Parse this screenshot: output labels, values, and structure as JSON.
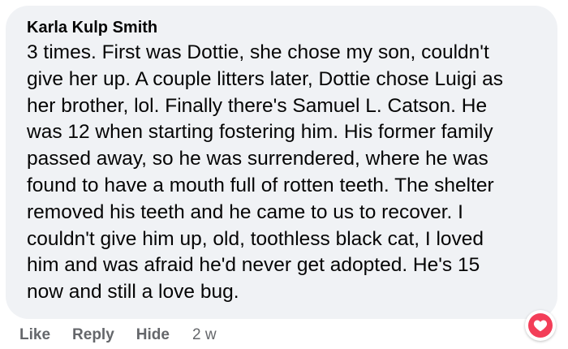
{
  "comment": {
    "author": "Karla Kulp Smith",
    "text": "3 times. First was Dottie, she chose my son, couldn't\ngive her up. A couple litters later, Dottie chose Luigi as\nher brother, lol. Finally there's Samuel L. Catson. He\nwas 12 when starting fostering him. His former family\npassed away, so he was surrendered, where he was\nfound to have a mouth full of rotten teeth. The shelter\nremoved his teeth and he came to us to recover. I\ncouldn't give him up, old, toothless black cat, I loved\nhim and was afraid he'd never get adopted. He's 15\nnow and still a love bug."
  },
  "actions": {
    "like_label": "Like",
    "reply_label": "Reply",
    "hide_label": "Hide",
    "timestamp": "2 w"
  },
  "reaction": {
    "icon": "heart-reaction-icon",
    "color": "#f33e58"
  },
  "colors": {
    "bubble_background": "#f0f2f5",
    "text": "#050505",
    "secondary_text": "#65676b"
  }
}
